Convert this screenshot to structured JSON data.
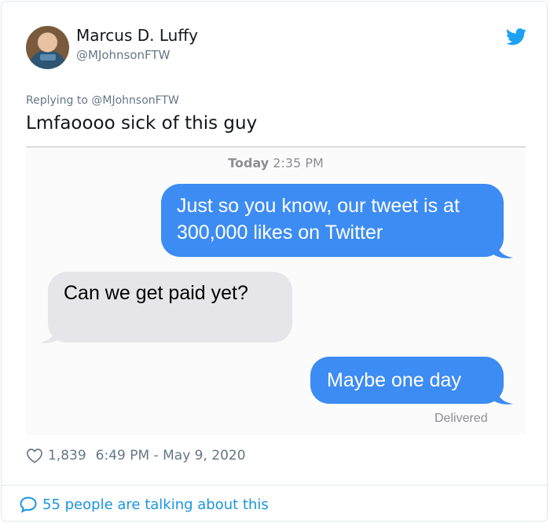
{
  "author": {
    "name": "Marcus D. Luffy",
    "handle": "@MJohnsonFTW"
  },
  "reply_to": "Replying to @MJohnsonFTW",
  "tweet_text": "Lmfaoooo sick of this guy",
  "screenshot": {
    "timestamp_day": "Today",
    "timestamp_time": "2:35 PM",
    "messages": [
      {
        "side": "sent",
        "text": "Just so you know, our tweet is at 300,000 likes on Twitter"
      },
      {
        "side": "received",
        "text": "Can we get paid yet?"
      },
      {
        "side": "sent",
        "text": "Maybe one day"
      }
    ],
    "status": "Delivered"
  },
  "footer": {
    "likes": "1,839",
    "datetime": "6:49 PM - May 9, 2020",
    "talking": "55 people are talking about this"
  },
  "colors": {
    "twitter_blue": "#1da1f2",
    "imessage_blue": "#3d8cf3",
    "received_gray": "#e6e6ea",
    "link_blue": "#1b95e0"
  },
  "icons": [
    "twitter-bird-icon",
    "heart-icon",
    "comment-bubble-icon"
  ]
}
